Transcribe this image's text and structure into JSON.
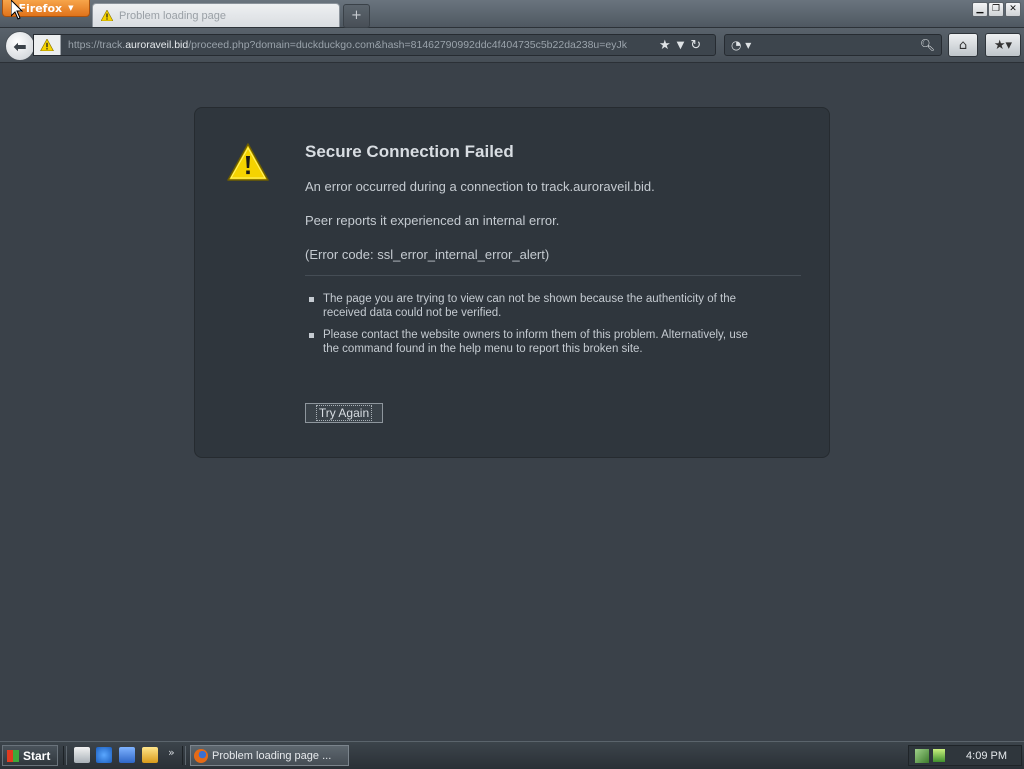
{
  "window": {
    "firefox_button_label": "Firefox",
    "tab_title": "Problem loading page"
  },
  "navigation": {
    "url_prefix": "https://track.",
    "url_domain": "auroraveil.bid",
    "url_rest": "/proceed.php?domain=duckduckgo.com&hash=81462790992ddc4f404735c5b22da238u=eyJk",
    "search_placeholder": ""
  },
  "error_page": {
    "title": "Secure Connection Failed",
    "line1": "An error occurred during a connection to track.auroraveil.bid.",
    "line2": "Peer reports it experienced an internal error.",
    "line3": "(Error code: ssl_error_internal_error_alert)",
    "bullets": [
      "The page you are trying to view can not be shown because the authenticity of the received data could not be verified.",
      "Please contact the website owners to inform them of this problem. Alternatively, use the command found in the help menu to report this broken site."
    ],
    "try_again_label": "Try Again"
  },
  "taskbar": {
    "start_label": "Start",
    "task_label": "Problem loading page ...",
    "clock": "4:09 PM"
  },
  "colors": {
    "page_background": "#3a4149",
    "error_box": "#2f363d",
    "firefox_orange": "#e0731a",
    "warning_yellow": "#f5d300"
  }
}
